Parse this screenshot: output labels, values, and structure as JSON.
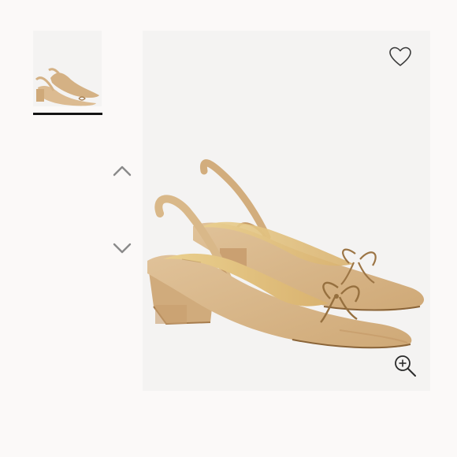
{
  "gallery": {
    "thumbnails": [
      {
        "icon": "slingback-pump-thumbnail",
        "selected": true
      }
    ],
    "controls": {
      "previous_icon": "chevron-up-icon",
      "next_icon": "chevron-down-icon"
    }
  },
  "main_image": {
    "icon": "slingback-pump-product-image",
    "favorite_icon": "heart-outline-icon",
    "zoom_icon": "zoom-in-icon"
  },
  "colors": {
    "page_background": "#fbf9f8",
    "image_background": "#f4f3f2",
    "suede": "#d9b88e",
    "suede_shadow": "#b98f61",
    "lining": "#e3c184",
    "icon_stroke": "#3a3a3a"
  }
}
